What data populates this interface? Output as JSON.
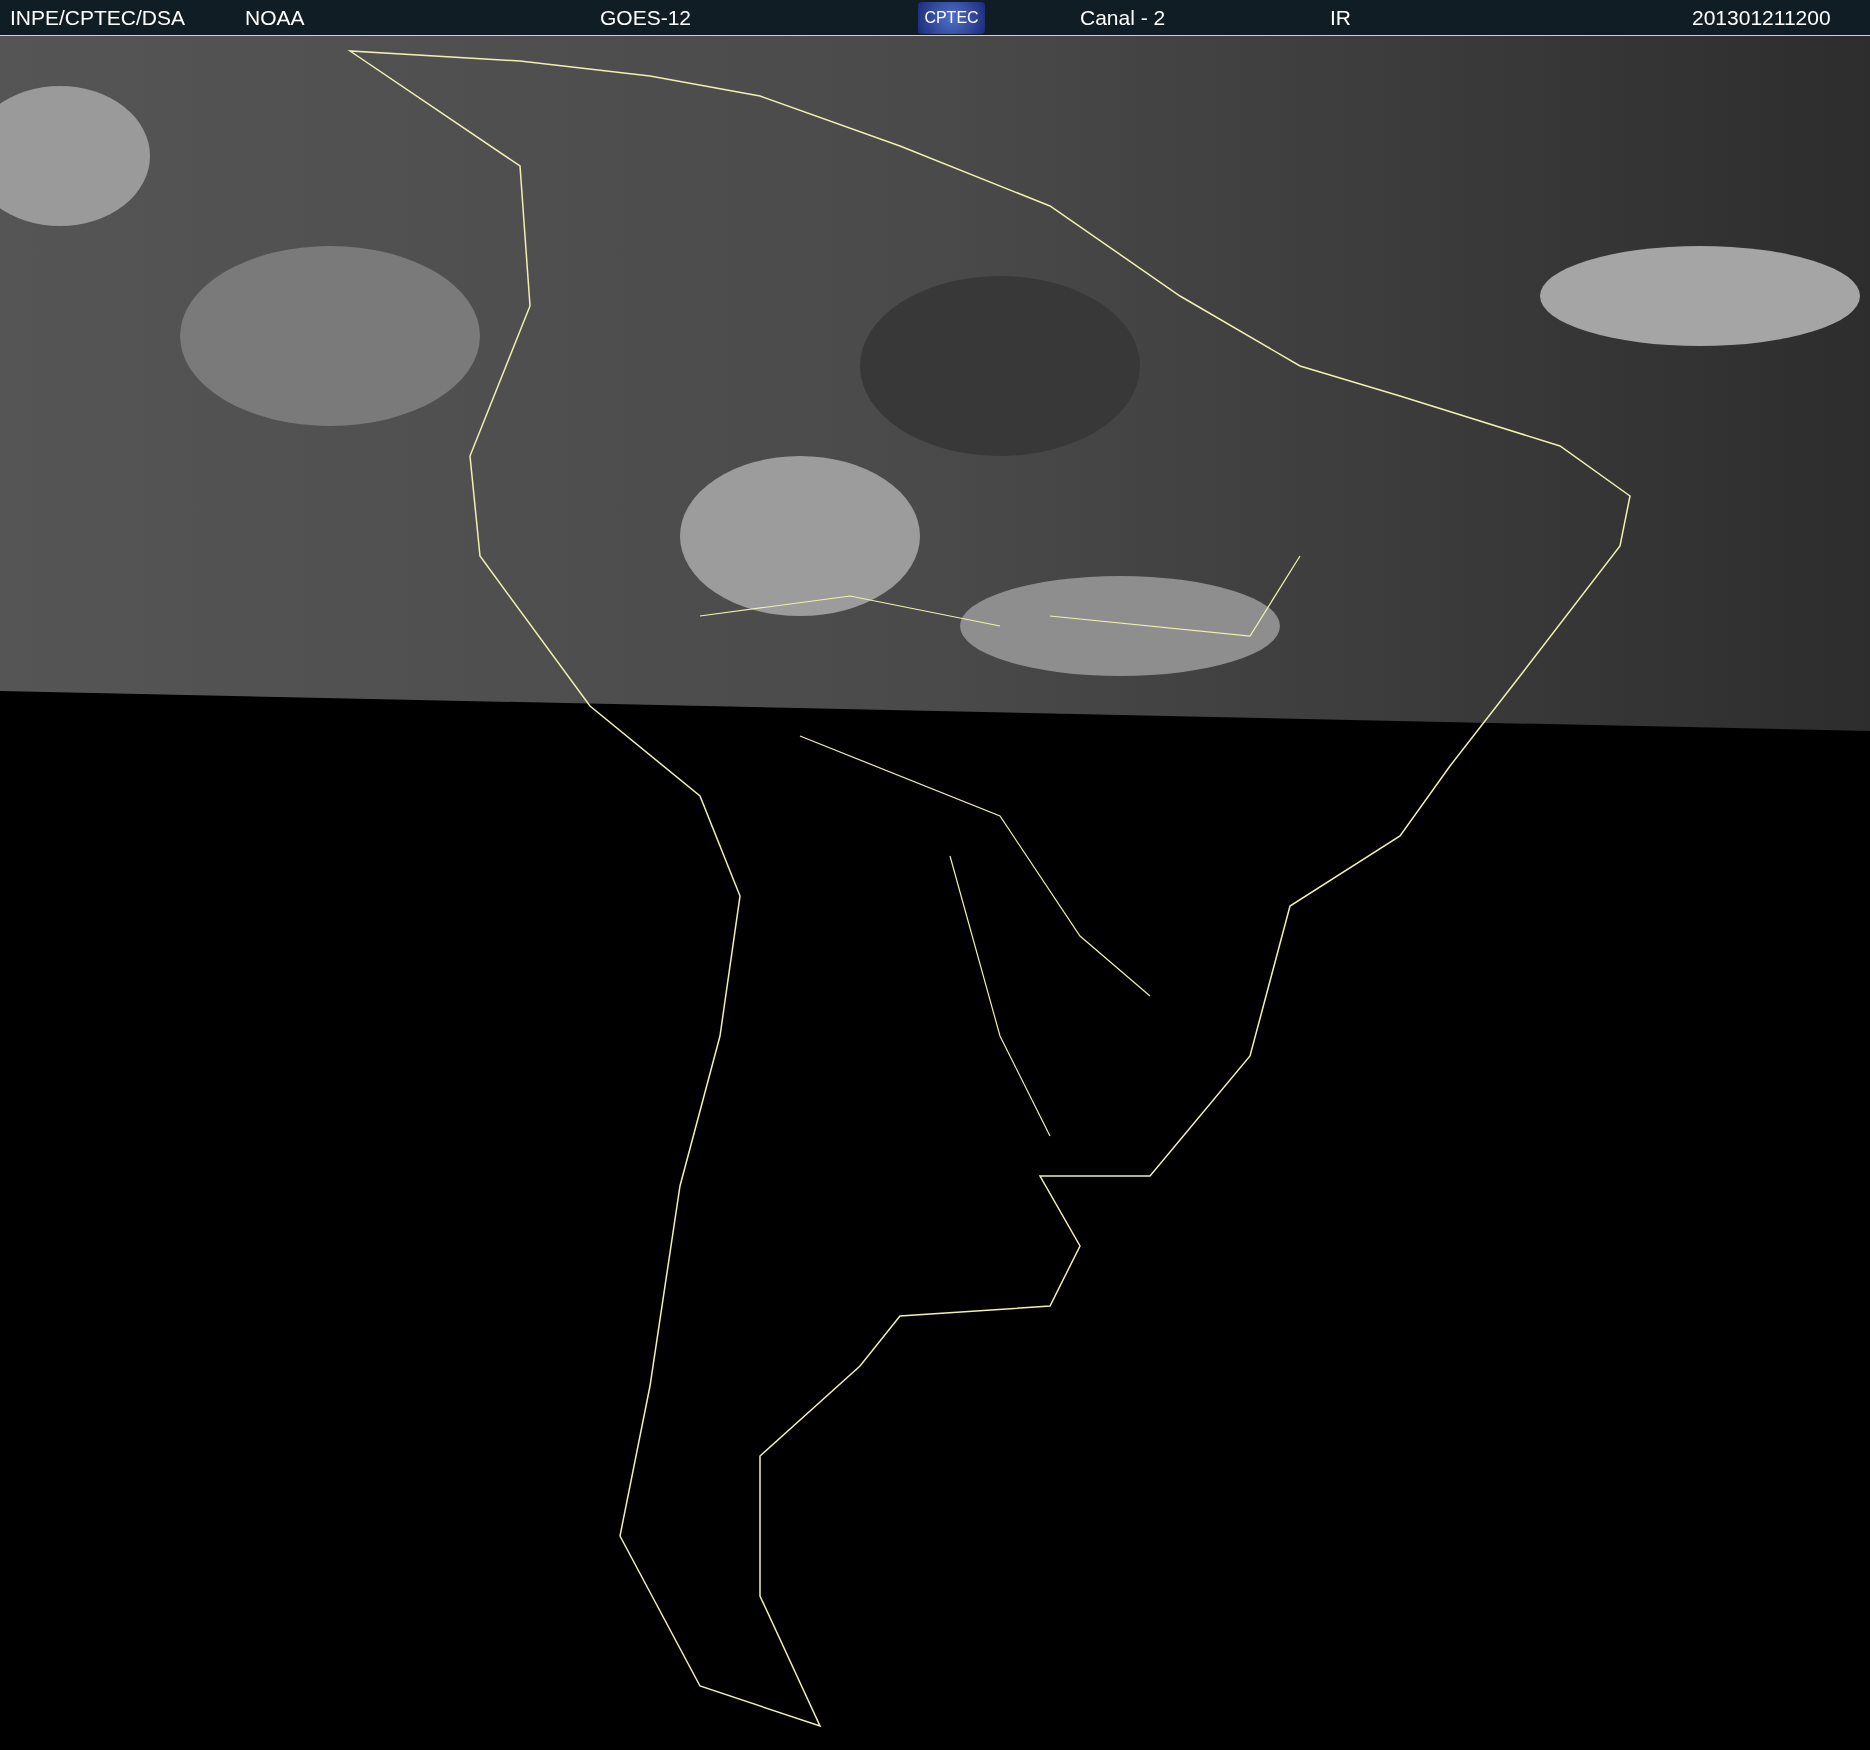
{
  "header": {
    "items": [
      {
        "kind": "text",
        "text": "INPE/CPTEC/DSA"
      },
      {
        "kind": "text",
        "text": "NOAA"
      },
      {
        "kind": "text",
        "text": "GOES-12"
      },
      {
        "kind": "logo",
        "text": "CPTEC"
      },
      {
        "kind": "text",
        "text": "Canal - 2"
      },
      {
        "kind": "text",
        "text": "IR"
      },
      {
        "kind": "text",
        "text": "201301211200"
      }
    ]
  }
}
